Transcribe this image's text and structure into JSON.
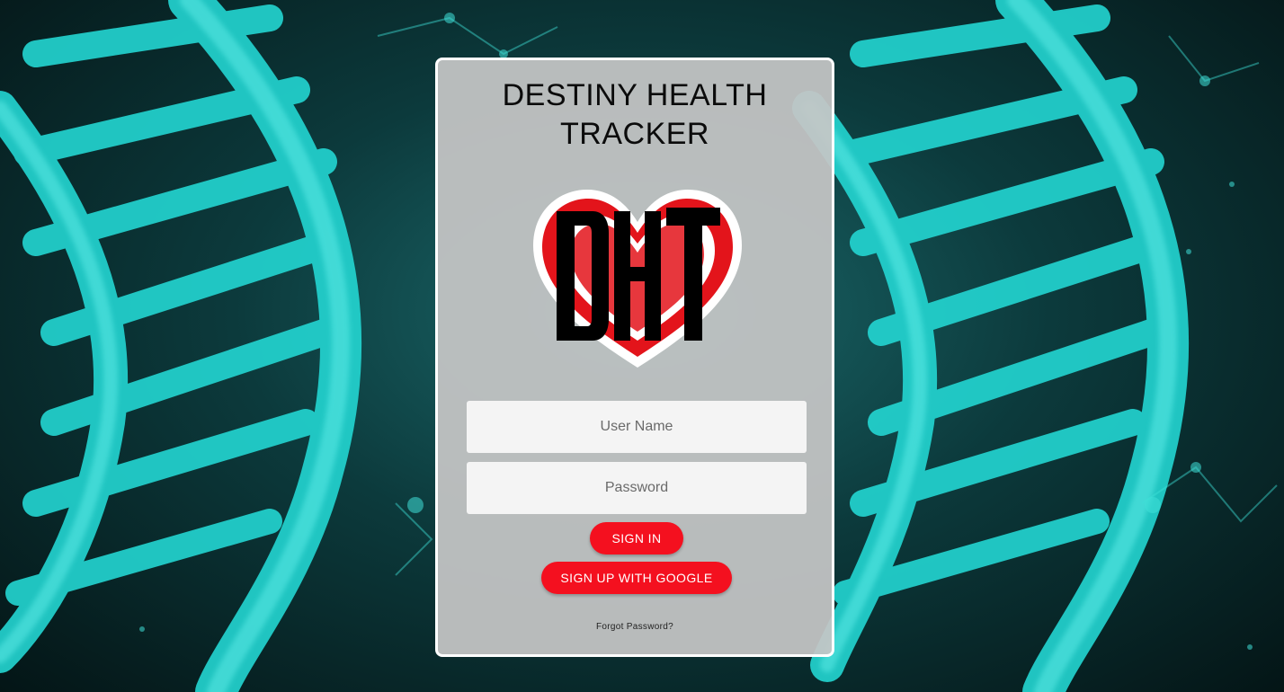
{
  "app": {
    "title": "DESTINY HEALTH TRACKER",
    "logo_text": "DHT"
  },
  "form": {
    "username_placeholder": "User Name",
    "username_value": "",
    "password_placeholder": "Password",
    "password_value": ""
  },
  "buttons": {
    "sign_in": "SIGN IN",
    "sign_up_google": "SIGN UP WITH GOOGLE"
  },
  "links": {
    "forgot_password": "Forgot Password?"
  },
  "colors": {
    "accent": "#f4101f",
    "card_background": "#c6c6c6",
    "background_glow": "#12e6e0",
    "logo_heart": "#e3141b",
    "logo_letters": "#000000"
  },
  "icons": {
    "logo": "dht-heart-logo",
    "background": "dna-helix-background"
  }
}
